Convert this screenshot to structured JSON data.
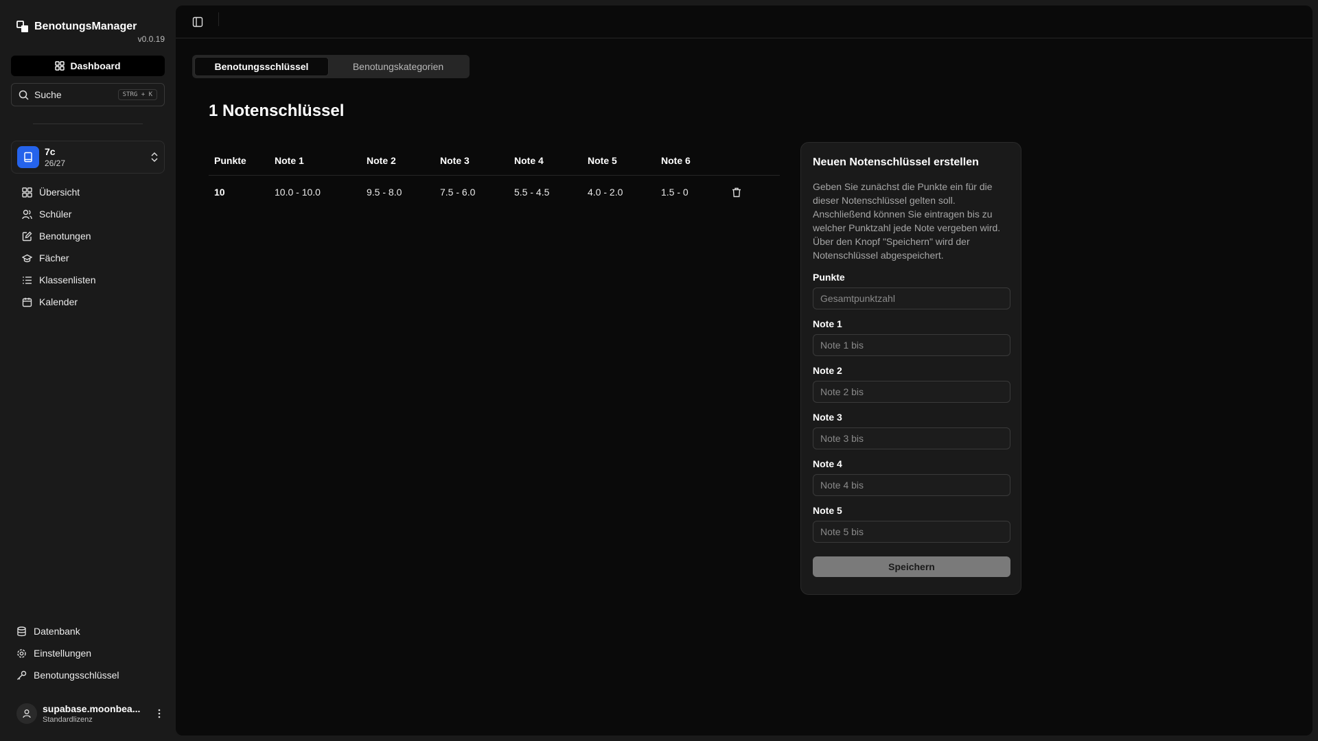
{
  "app": {
    "name": "BenotungsManager",
    "version": "v0.0.19"
  },
  "sidebar": {
    "dashboard_label": "Dashboard",
    "search": {
      "label": "Suche",
      "shortcut": "STRG + K"
    },
    "class_switch": {
      "name": "7c",
      "count": "26/27",
      "badge_color": "#2563eb"
    },
    "items": [
      {
        "label": "Übersicht",
        "icon": "grid-icon"
      },
      {
        "label": "Schüler",
        "icon": "users-icon"
      },
      {
        "label": "Benotungen",
        "icon": "edit-icon"
      },
      {
        "label": "Fächer",
        "icon": "graduation-cap-icon"
      },
      {
        "label": "Klassenlisten",
        "icon": "list-icon"
      },
      {
        "label": "Kalender",
        "icon": "calendar-icon"
      }
    ],
    "bottom_items": [
      {
        "label": "Datenbank",
        "icon": "database-icon"
      },
      {
        "label": "Einstellungen",
        "icon": "gear-icon"
      },
      {
        "label": "Benotungsschlüssel",
        "icon": "key-icon"
      }
    ],
    "user": {
      "name": "supabase.moonbea...",
      "license": "Standardlizenz"
    }
  },
  "main": {
    "tabs": [
      {
        "label": "Benotungsschlüssel",
        "active": true
      },
      {
        "label": "Benotungskategorien",
        "active": false
      }
    ],
    "title": "1 Notenschlüssel",
    "table": {
      "headers": [
        "Punkte",
        "Note 1",
        "Note 2",
        "Note 3",
        "Note 4",
        "Note 5",
        "Note 6"
      ],
      "rows": [
        {
          "cells": [
            "10",
            "10.0 - 10.0",
            "9.5 - 8.0",
            "7.5 - 6.0",
            "5.5 - 4.5",
            "4.0 - 2.0",
            "1.5 - 0"
          ]
        }
      ]
    },
    "form": {
      "title": "Neuen Notenschlüssel erstellen",
      "description": "Geben Sie zunächst die Punkte ein für die dieser Notenschlüssel gelten soll. Anschließend können Sie eintragen bis zu welcher Punktzahl jede Note vergeben wird. Über den Knopf \"Speichern\" wird der Notenschlüssel abgespeichert.",
      "fields": [
        {
          "label": "Punkte",
          "placeholder": "Gesamtpunktzahl",
          "value": ""
        },
        {
          "label": "Note 1",
          "placeholder": "Note 1 bis",
          "value": ""
        },
        {
          "label": "Note 2",
          "placeholder": "Note 2 bis",
          "value": ""
        },
        {
          "label": "Note 3",
          "placeholder": "Note 3 bis",
          "value": ""
        },
        {
          "label": "Note 4",
          "placeholder": "Note 4 bis",
          "value": ""
        },
        {
          "label": "Note 5",
          "placeholder": "Note 5 bis",
          "value": ""
        }
      ],
      "save_label": "Speichern"
    }
  }
}
